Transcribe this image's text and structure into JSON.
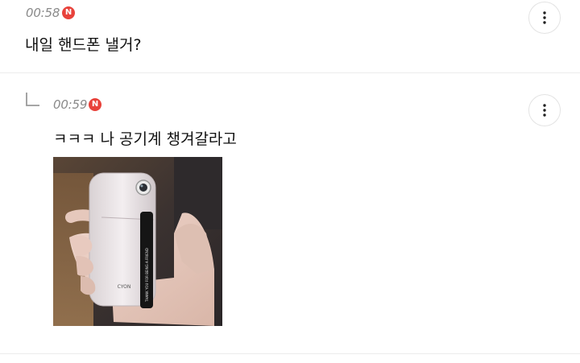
{
  "comments": [
    {
      "time": "00:58",
      "badge": "N",
      "text": "내일 핸드폰 낼거?",
      "more_icon": "more-vertical-icon"
    },
    {
      "is_reply": true,
      "reply_icon": "reply-arrow-icon",
      "time": "00:59",
      "badge": "N",
      "text": "ㅋㅋㅋ 나 공기계 챙겨갈라고",
      "more_icon": "more-vertical-icon",
      "photo": {
        "phone_brand": "CYON",
        "strap_text": "THANK YOU FOR BEING A FRIEND"
      }
    }
  ],
  "colors": {
    "new_badge": "#e8423b",
    "timestamp": "#8a8a8a",
    "divider": "#ececec"
  }
}
